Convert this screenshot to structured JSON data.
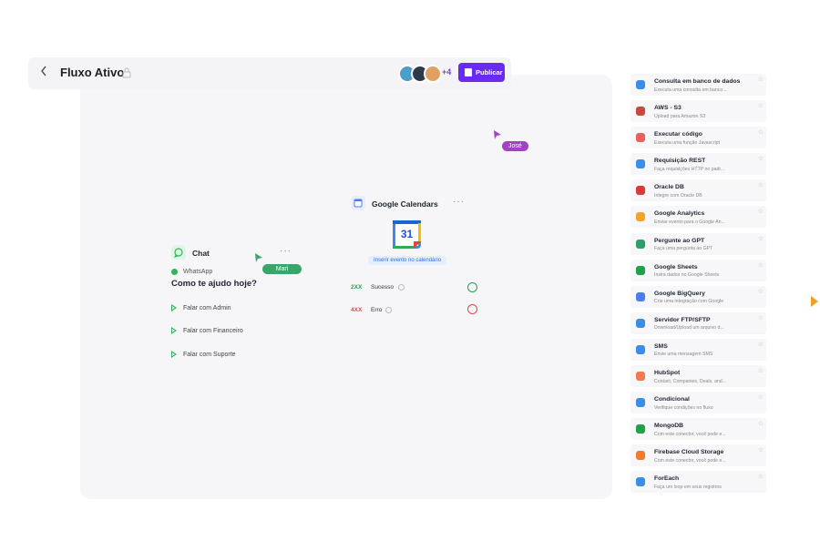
{
  "header": {
    "back_icon": "chevron-left-icon",
    "title": "Fluxo Ativo",
    "lock_icon": "lock-icon",
    "avatars_extra": "+4",
    "publish_label": "Publicar",
    "accent": "#6a2bf0"
  },
  "cursors": {
    "jose": {
      "name": "José",
      "color": "#a340c4"
    },
    "mari": {
      "name": "Mari",
      "color": "#3aa56b"
    }
  },
  "chat_node": {
    "title": "Chat",
    "channel": "WhatsApp",
    "question": "Como te ajudo hoje?",
    "options": [
      "Falar com Admin",
      "Falar com Financeiro",
      "Falar com Suporte"
    ]
  },
  "calendar_node": {
    "title": "Google Calendars",
    "calendar_day": "31",
    "action_label": "Inserir evento no calendário",
    "outputs": [
      {
        "code": "2XX",
        "label": "Sucesso",
        "color": "#21a04a"
      },
      {
        "code": "4XX",
        "label": "Erro",
        "color": "#e04848"
      }
    ]
  },
  "panel": {
    "items": [
      {
        "name": "Consulta em banco de dados",
        "desc": "Executa uma consulta em banco...",
        "icon": "database-icon",
        "color": "#3a8ee6"
      },
      {
        "name": "AWS - S3",
        "desc": "Upload para Amazon S3",
        "icon": "aws-s3-icon",
        "color": "#c94a3c"
      },
      {
        "name": "Executar código",
        "desc": "Executa uma função Javascript",
        "icon": "code-icon",
        "color": "#e86060"
      },
      {
        "name": "Requisição REST",
        "desc": "Faça requisições HTTP no padr...",
        "icon": "globe-icon",
        "color": "#3a8ee6"
      },
      {
        "name": "Oracle DB",
        "desc": "Integre com Oracle DB",
        "icon": "oracle-icon",
        "color": "#d83a3a"
      },
      {
        "name": "Google Analytics",
        "desc": "Enviar evento para o Google An...",
        "icon": "analytics-icon",
        "color": "#f2a428"
      },
      {
        "name": "Pergunte ao GPT",
        "desc": "Faça uma pergunta ao GPT",
        "icon": "gpt-icon",
        "color": "#2f9e6a"
      },
      {
        "name": "Google Sheets",
        "desc": "Insira dados no Google Sheets",
        "icon": "sheets-icon",
        "color": "#21a04a"
      },
      {
        "name": "Google BigQuery",
        "desc": "Crie uma integração com Google",
        "icon": "bigquery-icon",
        "color": "#4a7ef0"
      },
      {
        "name": "Servidor FTP/SFTP",
        "desc": "Download/Upload um arquivo d...",
        "icon": "server-icon",
        "color": "#3a8ee6"
      },
      {
        "name": "SMS",
        "desc": "Envie uma mensagem SMS",
        "icon": "send-icon",
        "color": "#3a8ee6"
      },
      {
        "name": "HubSpot",
        "desc": "Contact, Companies, Deals, and...",
        "icon": "hubspot-icon",
        "color": "#f07b50"
      },
      {
        "name": "Condicional",
        "desc": "Verifique condições no fluxo",
        "icon": "branch-icon",
        "color": "#3a8ee6"
      },
      {
        "name": "MongoDB",
        "desc": "Com este conector, você pode e...",
        "icon": "mongodb-icon",
        "color": "#21a04a"
      },
      {
        "name": "Firebase Cloud Storage",
        "desc": "Com este conector, você pode e...",
        "icon": "firebase-icon",
        "color": "#f07b30"
      },
      {
        "name": "ForEach",
        "desc": "Faça um loop em seus registros",
        "icon": "loop-icon",
        "color": "#3a8ee6"
      }
    ]
  }
}
